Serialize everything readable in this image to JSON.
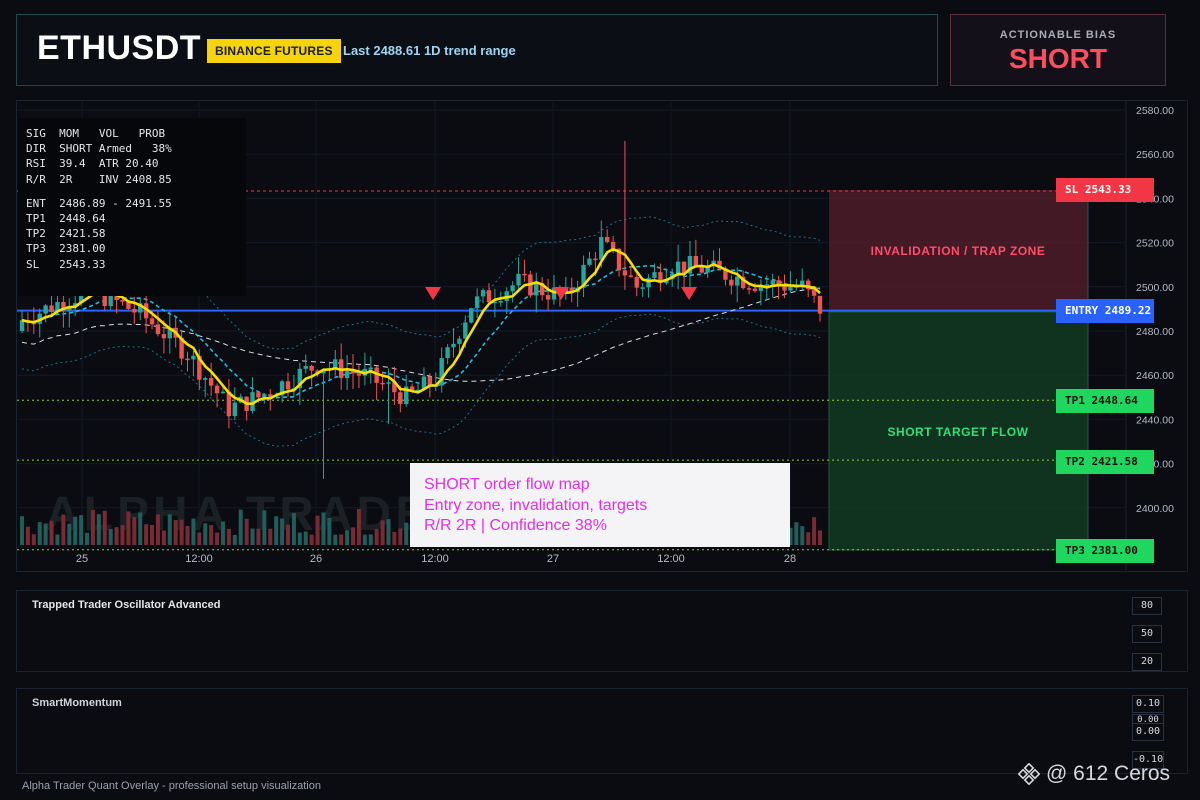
{
  "header": {
    "symbol": "ETHUSDT",
    "exchange": "BINANCE FUTURES",
    "last_price": "Last 2488.61  1D trend range"
  },
  "bias": {
    "label": "ACTIONABLE BIAS",
    "value": "SHORT"
  },
  "stats": {
    "rows": [
      "SIG  MOM   VOL   PROB",
      "DIR  SHORT Armed   38%",
      "RSI  39.4  ATR 20.40",
      "R/R  2R    INV 2408.85",
      "",
      "ENT  2486.89 - 2491.55",
      "TP1  2448.64",
      "TP2  2421.58",
      "TP3  2381.00",
      "SL   2543.33"
    ]
  },
  "levels": {
    "sl": "SL 2543.33",
    "entry": "ENTRY 2489.22",
    "tp1": "TP1 2448.64",
    "tp2": "TP2 2421.58",
    "tp3": "TP3 2381.00"
  },
  "zones": {
    "trap": "INVALIDATION / TRAP ZONE",
    "target": "SHORT TARGET FLOW"
  },
  "note": {
    "lines": [
      "SHORT order flow map",
      "Entry zone, invalidation, targets",
      "R/R 2R | Confidence 38%"
    ]
  },
  "watermark": "ALPHA TRADER",
  "price_axis": [
    "2580.00",
    "2560.00",
    "2540.00",
    "2520.00",
    "2500.00",
    "2480.00",
    "2460.00",
    "2440.00",
    "2420.00",
    "2400.00"
  ],
  "time_axis": [
    "25",
    "12:00",
    "26",
    "12:00",
    "27",
    "12:00",
    "28"
  ],
  "oscillator": {
    "title": "Trapped Trader Oscillator Advanced",
    "scale": [
      "80",
      "50",
      "20"
    ]
  },
  "momentum": {
    "title": "SmartMomentum",
    "scale": [
      "0.10",
      "0.00",
      "0.00",
      "-0.10"
    ]
  },
  "footer": "Alpha Trader Quant Overlay - professional setup visualization",
  "brand": "@ 612 Ceros",
  "colors": {
    "bull": "#26a69a",
    "bear": "#ef5350",
    "entry": "#2962ff",
    "ema": "#f5e000",
    "osc": "#e040fb",
    "accent_short": "#ff4d5e"
  },
  "icons": [
    "sell-signal-arrow-icon",
    "binance-logo-icon"
  ]
}
